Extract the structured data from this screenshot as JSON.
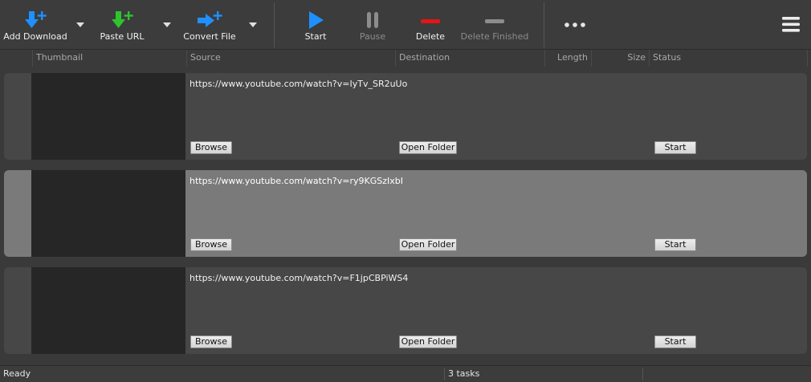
{
  "toolbar": {
    "add_download": "Add Download",
    "paste_url": "Paste URL",
    "convert_file": "Convert File",
    "start": "Start",
    "pause": "Pause",
    "delete": "Delete",
    "delete_finished": "Delete Finished",
    "more": "•••"
  },
  "colors": {
    "accent_blue": "#1e90ff",
    "accent_green": "#2ec42e",
    "delete_red": "#e81414",
    "disabled_gray": "#8c8c8c"
  },
  "columns": {
    "thumbnail": "Thumbnail",
    "source": "Source",
    "destination": "Destination",
    "length": "Length",
    "size": "Size",
    "status": "Status"
  },
  "rows": [
    {
      "source": "https://www.youtube.com/watch?v=IyTv_SR2uUo",
      "browse": "Browse",
      "open_folder": "Open Folder",
      "start": "Start"
    },
    {
      "source": "https://www.youtube.com/watch?v=ry9KGSzIxbI",
      "browse": "Browse",
      "open_folder": "Open Folder",
      "start": "Start"
    },
    {
      "source": "https://www.youtube.com/watch?v=F1jpCBPiWS4",
      "browse": "Browse",
      "open_folder": "Open Folder",
      "start": "Start"
    }
  ],
  "status_bar": {
    "state": "Ready",
    "tasks": "3 tasks"
  }
}
